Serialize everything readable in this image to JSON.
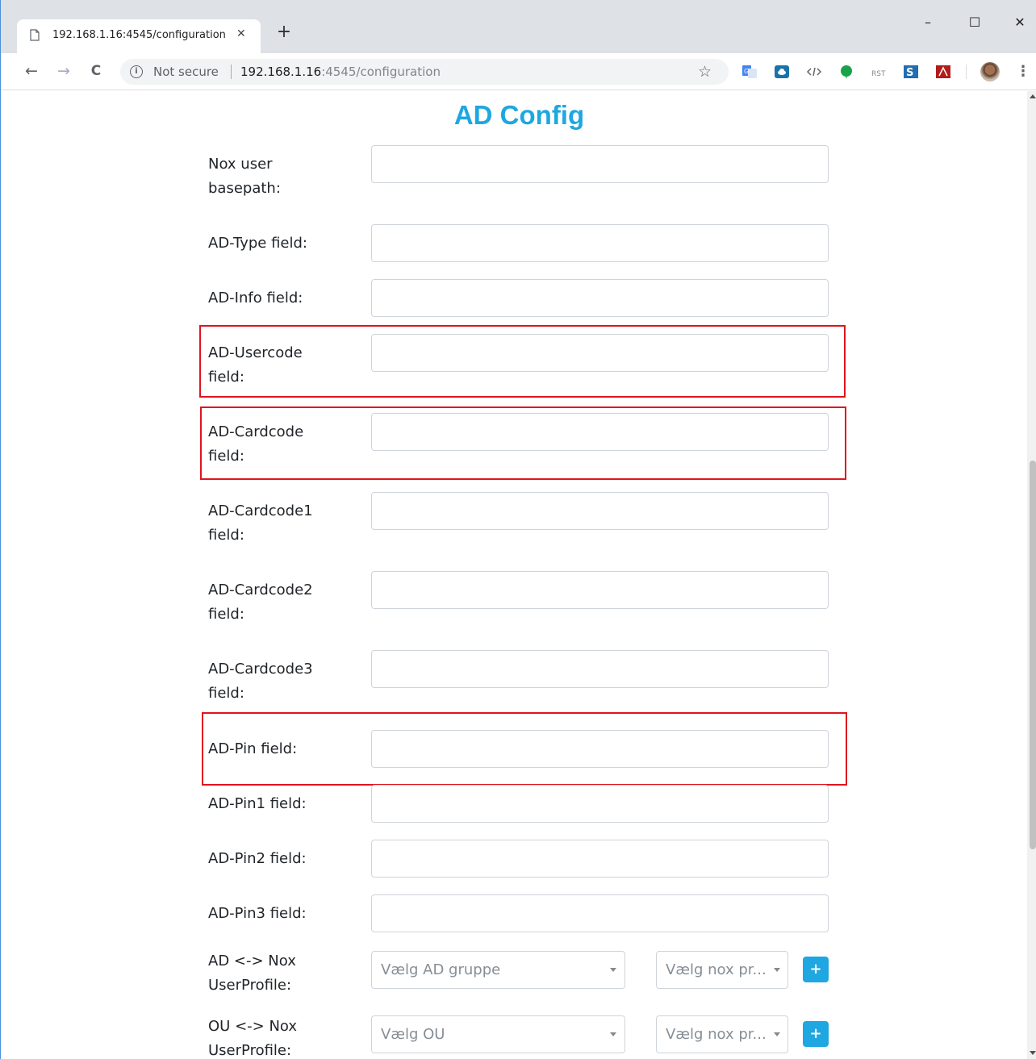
{
  "browser": {
    "tab_title": "192.168.1.16:4545/configuration",
    "tab_close": "✕",
    "new_tab": "+",
    "security_label": "Not secure",
    "url_host": "192.168.1.16",
    "url_rest": ":4545/configuration",
    "window_controls": {
      "minimize": "–",
      "maximize": "☐",
      "close": "✕"
    },
    "nav": {
      "back": "←",
      "forward": "→",
      "reload": "C"
    },
    "bookmark_star": "☆",
    "menu": "⋮",
    "extension_icons": [
      "google-translate-icon",
      "cloud-icon",
      "code-icon",
      "evernote-icon",
      "rst-icon",
      "s-icon",
      "pdf-icon"
    ]
  },
  "page": {
    "title": "AD Config",
    "fields": [
      {
        "id": "nox_user_basepath",
        "label": "Nox user basepath:",
        "value": ""
      },
      {
        "id": "ad_type",
        "label": "AD-Type field:",
        "value": ""
      },
      {
        "id": "ad_info",
        "label": "AD-Info field:",
        "value": ""
      },
      {
        "id": "ad_usercode",
        "label": "AD-Usercode field:",
        "value": "",
        "highlighted": true
      },
      {
        "id": "ad_cardcode",
        "label": "AD-Cardcode field:",
        "value": "",
        "highlighted": true
      },
      {
        "id": "ad_cardcode1",
        "label": "AD-Cardcode1 field:",
        "value": ""
      },
      {
        "id": "ad_cardcode2",
        "label": "AD-Cardcode2 field:",
        "value": ""
      },
      {
        "id": "ad_cardcode3",
        "label": "AD-Cardcode3 field:",
        "value": ""
      },
      {
        "id": "ad_pin",
        "label": "AD-Pin field:",
        "value": "",
        "highlighted": true
      },
      {
        "id": "ad_pin1",
        "label": "AD-Pin1 field:",
        "value": ""
      },
      {
        "id": "ad_pin2",
        "label": "AD-Pin2 field:",
        "value": ""
      },
      {
        "id": "ad_pin3",
        "label": "AD-Pin3 field:",
        "value": ""
      }
    ],
    "mappings": [
      {
        "label": "AD <-> Nox UserProfile:",
        "select_left": "Vælg AD gruppe",
        "select_right": "Vælg nox pr...",
        "add": "+"
      },
      {
        "label": "OU <-> Nox UserProfile:",
        "select_left": "Vælg OU",
        "select_right": "Vælg nox pr...",
        "add": "+"
      }
    ]
  },
  "colors": {
    "accent": "#1ea7e0",
    "highlight_border": "#e0141e"
  }
}
